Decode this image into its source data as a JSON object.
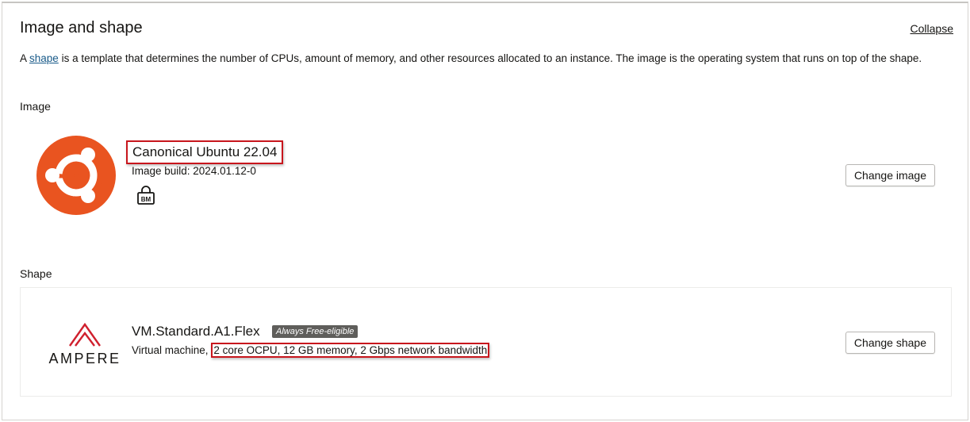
{
  "header": {
    "title": "Image and shape",
    "collapse_label": "Collapse"
  },
  "description": {
    "prefix": "A ",
    "link_text": "shape",
    "suffix": " is a template that determines the number of CPUs, amount of memory, and other resources allocated to an instance. The image is the operating system that runs on top of the shape."
  },
  "image": {
    "label": "Image",
    "name": "Canonical Ubuntu 22.04",
    "build": "Image build: 2024.01.12-0",
    "bm_icon_text": "BM",
    "change_button": "Change image",
    "logo_icon": "ubuntu-logo",
    "logo_color": "#e95420"
  },
  "shape": {
    "label": "Shape",
    "name": "VM.Standard.A1.Flex",
    "badge": "Always Free-eligible",
    "desc_prefix": "Virtual machine, ",
    "desc_specs": "2 core OCPU, 12 GB memory, 2 Gbps network bandwidth",
    "change_button": "Change shape",
    "logo_text": "AMPERE",
    "logo_color": "#d0202e"
  },
  "colors": {
    "highlight_box": "#c8161d",
    "link": "#1a5b8a"
  }
}
